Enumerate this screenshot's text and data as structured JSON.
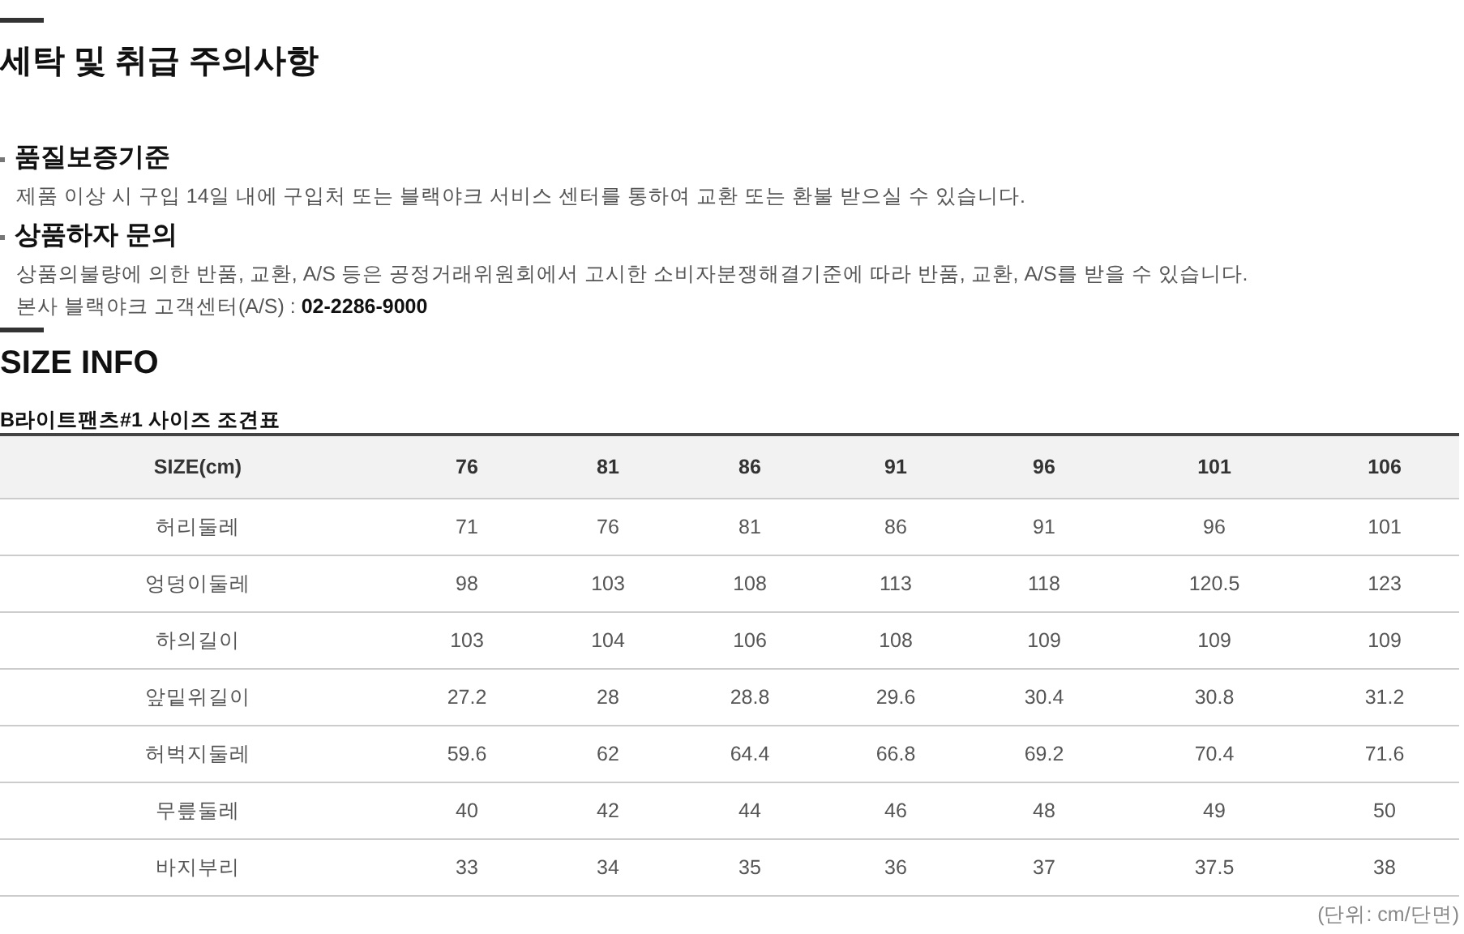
{
  "care": {
    "title": "세탁 및 취급 주의사항",
    "sections": [
      {
        "heading": "품질보증기준",
        "lines": [
          "제품 이상 시 구입 14일 내에 구입처 또는 블랙야크 서비스 센터를 통하여 교환 또는 환불 받으실 수 있습니다."
        ]
      },
      {
        "heading": "상품하자 문의",
        "lines": [
          "상품의불량에 의한 반품, 교환, A/S 등은 공정거래위원회에서 고시한 소비자분쟁해결기준에 따라 반품, 교환, A/S를 받을 수 있습니다.",
          "본사 블랙야크 고객센터(A/S) : **02-2286-9000**"
        ]
      }
    ]
  },
  "size_info": {
    "title": "SIZE INFO",
    "table_title": "B라이트팬츠#1 사이즈 조견표",
    "table": {
      "columns": [
        "SIZE(cm)",
        "76",
        "81",
        "86",
        "91",
        "96",
        "101",
        "106"
      ],
      "rows": [
        [
          "허리둘레",
          "71",
          "76",
          "81",
          "86",
          "91",
          "96",
          "101"
        ],
        [
          "엉덩이둘레",
          "98",
          "103",
          "108",
          "113",
          "118",
          "120.5",
          "123"
        ],
        [
          "하의길이",
          "103",
          "104",
          "106",
          "108",
          "109",
          "109",
          "109"
        ],
        [
          "앞밑위길이",
          "27.2",
          "28",
          "28.8",
          "29.6",
          "30.4",
          "30.8",
          "31.2"
        ],
        [
          "허벅지둘레",
          "59.6",
          "62",
          "64.4",
          "66.8",
          "69.2",
          "70.4",
          "71.6"
        ],
        [
          "무릎둘레",
          "40",
          "42",
          "44",
          "46",
          "48",
          "49",
          "50"
        ],
        [
          "바지부리",
          "33",
          "34",
          "35",
          "36",
          "37",
          "37.5",
          "38"
        ]
      ]
    },
    "unit_note": "(단위: cm/단면)"
  }
}
